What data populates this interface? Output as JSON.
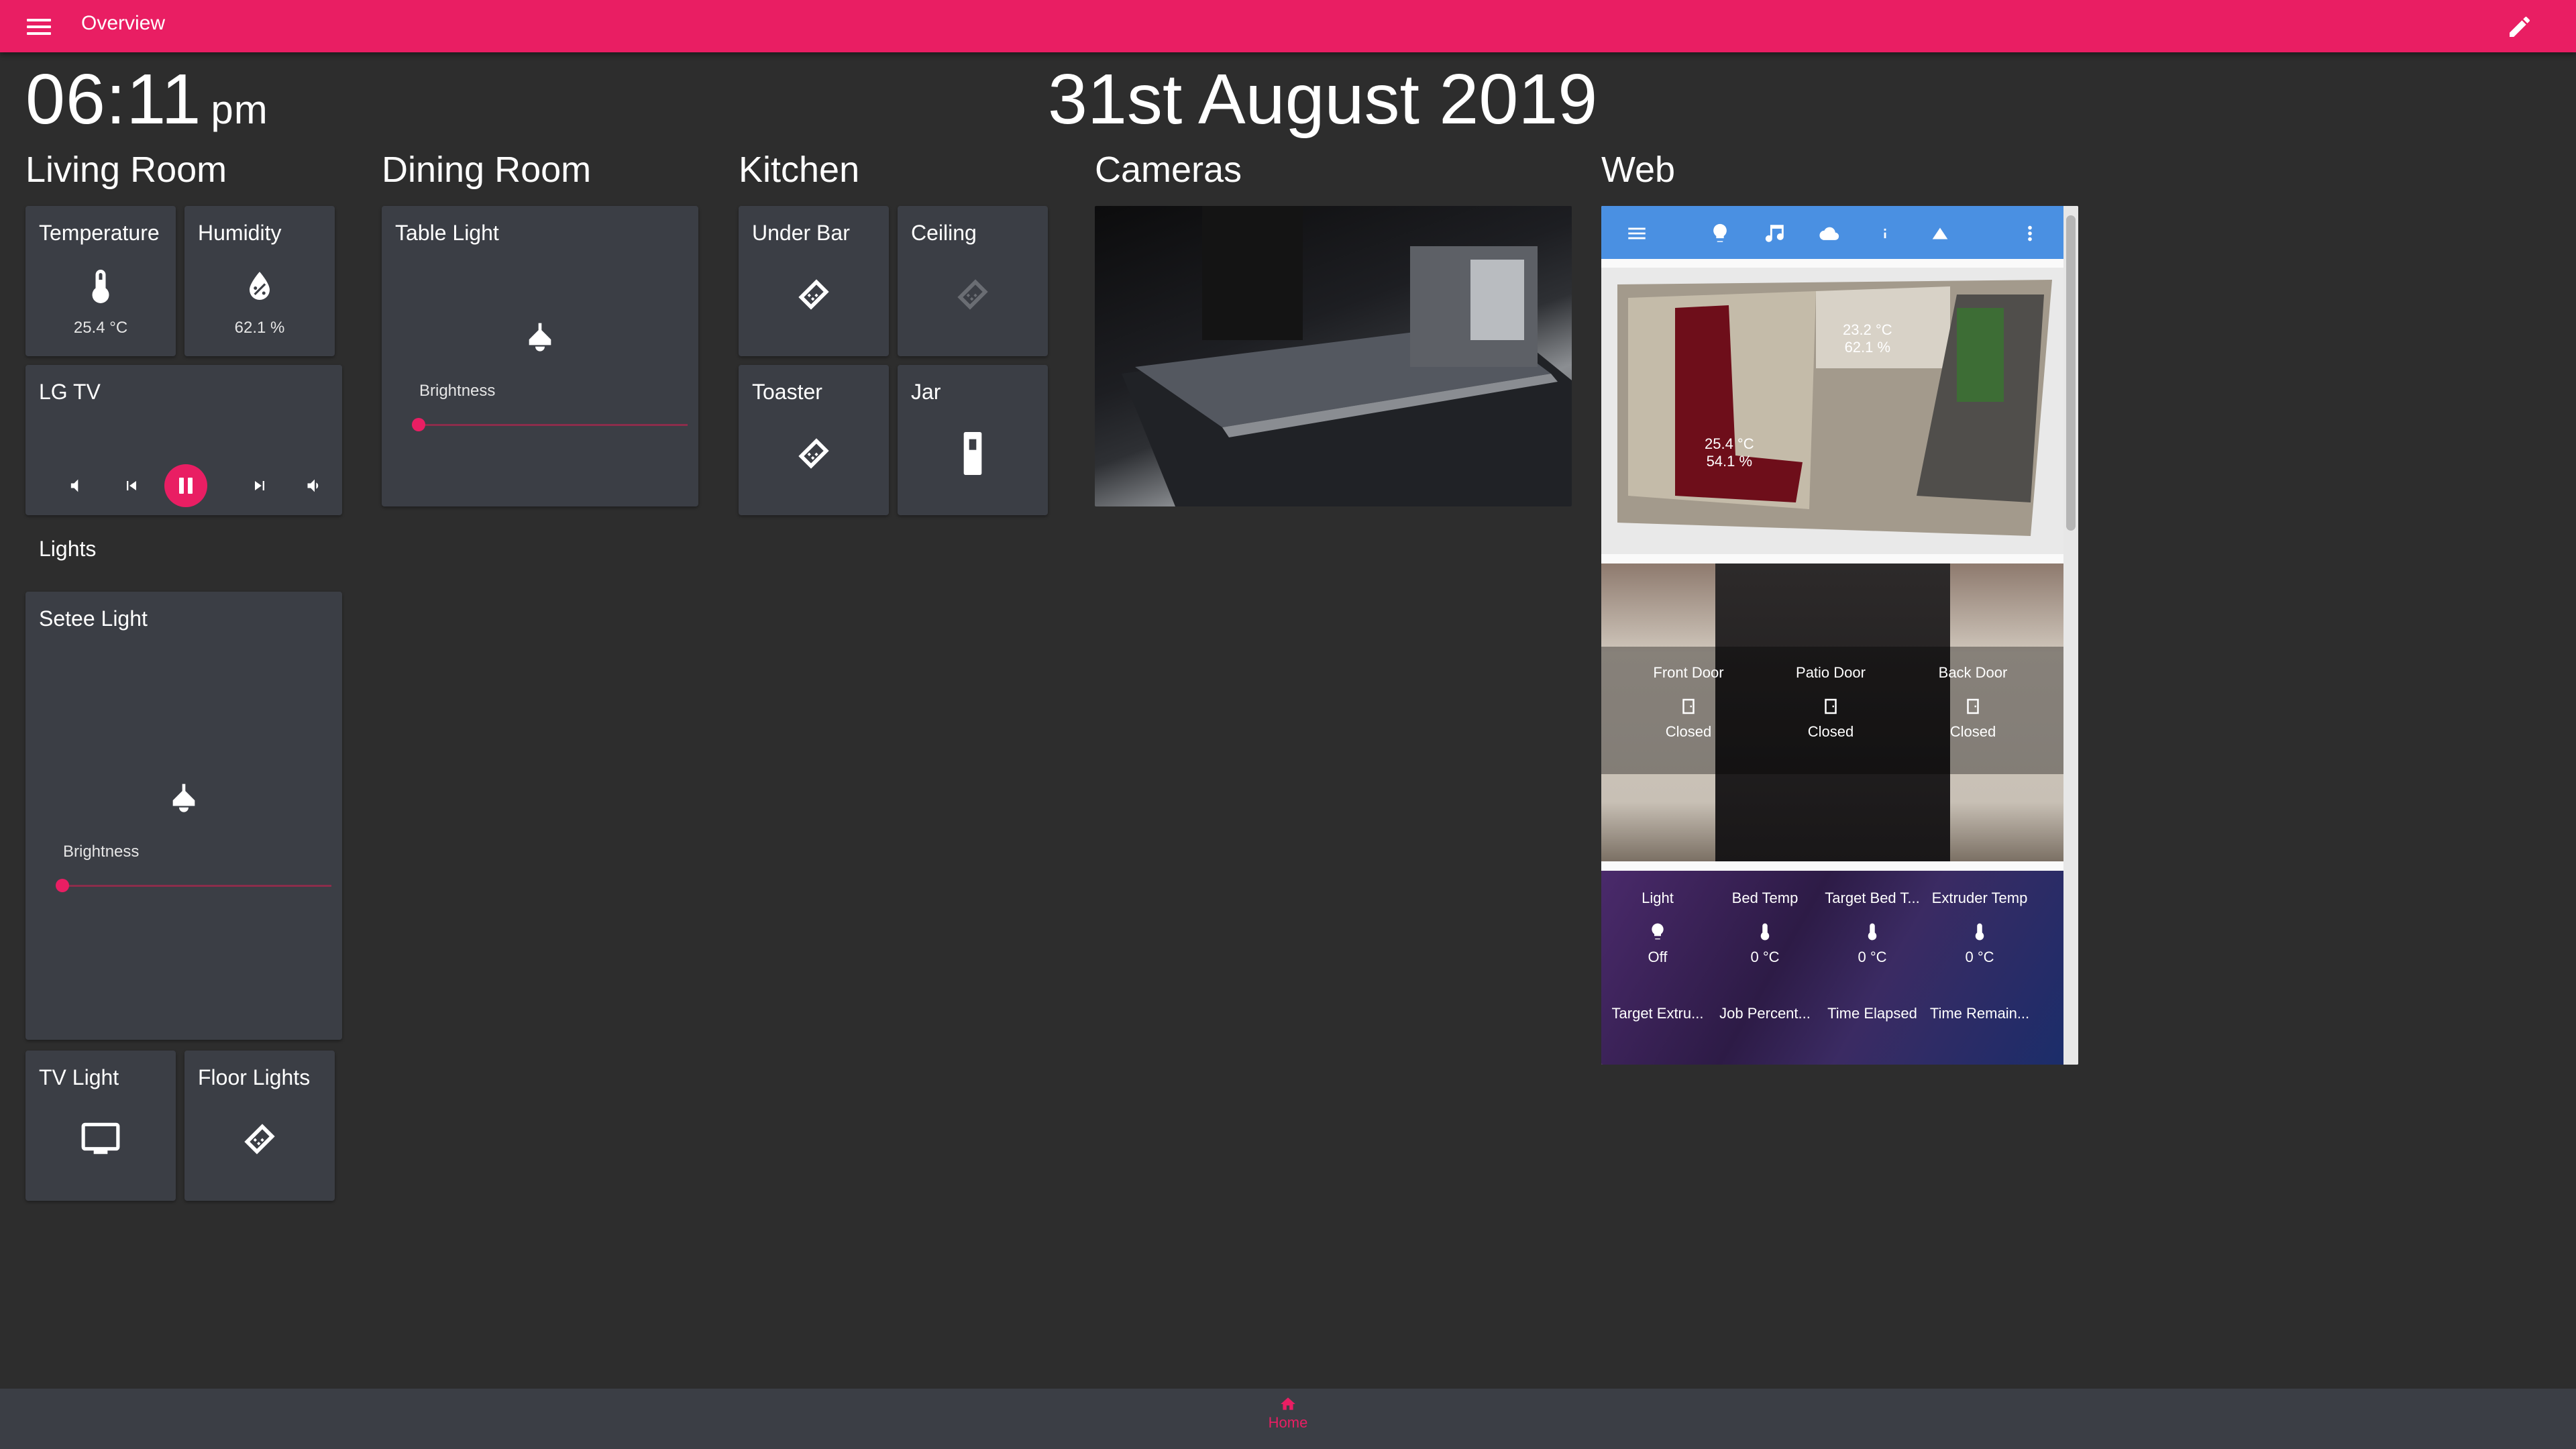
{
  "header": {
    "title": "Overview"
  },
  "clock": {
    "time": "06:11",
    "ampm": "pm",
    "date": "31st August 2019"
  },
  "columns": {
    "living_room": "Living Room",
    "dining_room": "Dining Room",
    "kitchen": "Kitchen",
    "cameras": "Cameras",
    "web": "Web"
  },
  "living": {
    "temperature": {
      "label": "Temperature",
      "value": "25.4 °C"
    },
    "humidity": {
      "label": "Humidity",
      "value": "62.1 %"
    },
    "tv": {
      "label": "LG TV"
    },
    "lights_label": "Lights",
    "setee": {
      "label": "Setee Light",
      "brightness": "Brightness",
      "level": 0
    },
    "tv_light": {
      "label": "TV Light"
    },
    "floor_lights": {
      "label": "Floor Lights"
    }
  },
  "dining": {
    "table_light": {
      "label": "Table Light",
      "brightness": "Brightness",
      "level": 0
    }
  },
  "kitchen": {
    "under_bar": {
      "label": "Under Bar"
    },
    "ceiling": {
      "label": "Ceiling"
    },
    "toaster": {
      "label": "Toaster"
    },
    "jar": {
      "label": "Jar"
    }
  },
  "web": {
    "floorplan": {
      "upstairs": "23.2 °C",
      "upstairs_hum": "62.1 %",
      "downstairs": "25.4 °C",
      "downstairs_hum": "54.1 %"
    },
    "doors": [
      {
        "name": "Front Door",
        "state": "Closed"
      },
      {
        "name": "Patio Door",
        "state": "Closed"
      },
      {
        "name": "Back Door",
        "state": "Closed"
      }
    ],
    "printer_row1": [
      {
        "name": "Light",
        "value": "Off"
      },
      {
        "name": "Bed Temp",
        "value": "0 °C"
      },
      {
        "name": "Target Bed T...",
        "value": "0 °C"
      },
      {
        "name": "Extruder Temp",
        "value": "0 °C"
      }
    ],
    "printer_row2": [
      {
        "name": "Target Extru..."
      },
      {
        "name": "Job Percent..."
      },
      {
        "name": "Time Elapsed"
      },
      {
        "name": "Time Remain..."
      }
    ]
  },
  "nav": {
    "home": "Home"
  },
  "colors": {
    "accent": "#e91e63",
    "card": "#3b3e45",
    "background": "#2d2d2d",
    "web_bar": "#4a90e2"
  }
}
